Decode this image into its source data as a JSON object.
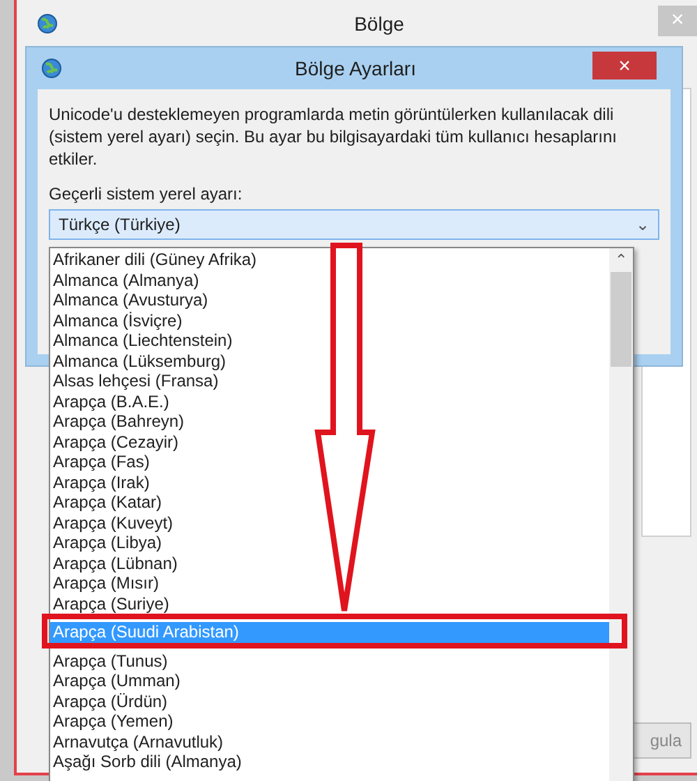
{
  "window": {
    "title": "Bölge",
    "close": "×",
    "button": "gula"
  },
  "dialog": {
    "title": "Bölge Ayarları",
    "close": "×",
    "description": "Unicode'u desteklemeyen programlarda metin görüntülerken kullanılacak dili (sistem yerel ayarı) seçin. Bu ayar bu bilgisayardaki tüm kullanıcı hesaplarını etkiler.",
    "label": "Geçerli sistem yerel ayarı:",
    "combo": {
      "value": "Türkçe (Türkiye)",
      "caret": "⌄",
      "expanded": true
    },
    "list": {
      "scroll_up": "⌃",
      "items": [
        {
          "label": "Afrikaner dili (Güney Afrika)",
          "selected": false
        },
        {
          "label": "Almanca (Almanya)",
          "selected": false
        },
        {
          "label": "Almanca (Avusturya)",
          "selected": false
        },
        {
          "label": "Almanca (İsviçre)",
          "selected": false
        },
        {
          "label": "Almanca (Liechtenstein)",
          "selected": false
        },
        {
          "label": "Almanca (Lüksemburg)",
          "selected": false
        },
        {
          "label": "Alsas lehçesi (Fransa)",
          "selected": false
        },
        {
          "label": "Arapça (B.A.E.)",
          "selected": false
        },
        {
          "label": "Arapça (Bahreyn)",
          "selected": false
        },
        {
          "label": "Arapça (Cezayir)",
          "selected": false
        },
        {
          "label": "Arapça (Fas)",
          "selected": false
        },
        {
          "label": "Arapça (Irak)",
          "selected": false
        },
        {
          "label": "Arapça (Katar)",
          "selected": false
        },
        {
          "label": "Arapça (Kuveyt)",
          "selected": false
        },
        {
          "label": "Arapça (Libya)",
          "selected": false
        },
        {
          "label": "Arapça (Lübnan)",
          "selected": false
        },
        {
          "label": "Arapça (Mısır)",
          "selected": false
        },
        {
          "label": "Arapça (Suriye)",
          "selected": false
        },
        {
          "label": "Arapça (Suudi Arabistan)",
          "selected": true
        },
        {
          "label": "Arapça (Tunus)",
          "selected": false
        },
        {
          "label": "Arapça (Umman)",
          "selected": false
        },
        {
          "label": "Arapça (Ürdün)",
          "selected": false
        },
        {
          "label": "Arapça (Yemen)",
          "selected": false
        },
        {
          "label": "Arnavutça (Arnavutluk)",
          "selected": false
        },
        {
          "label": "Aşağı Sorb dili (Almanya)",
          "selected": false
        }
      ]
    }
  }
}
